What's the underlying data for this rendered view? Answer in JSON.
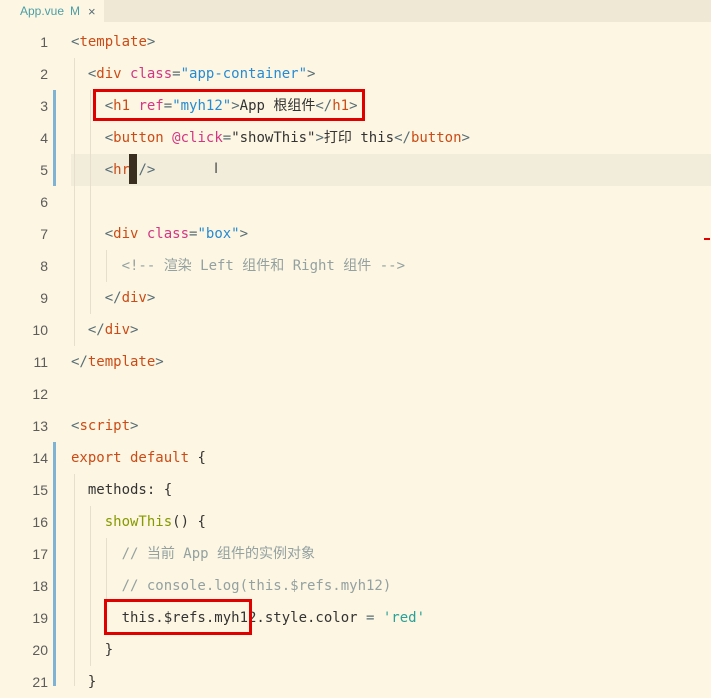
{
  "tab": {
    "filename": "App.vue",
    "status": "M",
    "close": "×"
  },
  "lines": [
    {
      "n": "1",
      "segs": [
        [
          "t-br",
          "<"
        ],
        [
          "t-tag",
          "template"
        ],
        [
          "t-br",
          ">"
        ]
      ]
    },
    {
      "n": "2",
      "segs": [
        [
          "t-br",
          "  <"
        ],
        [
          "t-tag",
          "div "
        ],
        [
          "t-attr",
          "class"
        ],
        [
          "t-br",
          "="
        ],
        [
          "t-str",
          "\"app-container\""
        ],
        [
          "t-br",
          ">"
        ]
      ]
    },
    {
      "n": "3",
      "segs": [
        [
          "t-br",
          "    <"
        ],
        [
          "t-tag",
          "h1 "
        ],
        [
          "t-attr",
          "ref"
        ],
        [
          "t-br",
          "="
        ],
        [
          "t-str",
          "\"myh12\""
        ],
        [
          "t-br",
          ">"
        ],
        [
          "t-text",
          "App 根组件"
        ],
        [
          "t-br",
          "</"
        ],
        [
          "t-tag",
          "h1"
        ],
        [
          "t-br",
          ">"
        ]
      ]
    },
    {
      "n": "4",
      "segs": [
        [
          "t-br",
          "    <"
        ],
        [
          "t-tag",
          "button "
        ],
        [
          "t-attr",
          "@click"
        ],
        [
          "t-br",
          "="
        ],
        [
          "t-text",
          "\"showThis\""
        ],
        [
          "t-br",
          ">"
        ],
        [
          "t-text",
          "打印 this"
        ],
        [
          "t-br",
          "</"
        ],
        [
          "t-tag",
          "button"
        ],
        [
          "t-br",
          ">"
        ]
      ]
    },
    {
      "n": "5",
      "segs": [
        [
          "t-br",
          "    <"
        ],
        [
          "t-tag",
          "hr"
        ],
        [
          "t-br",
          " />"
        ]
      ]
    },
    {
      "n": "6",
      "segs": []
    },
    {
      "n": "7",
      "segs": [
        [
          "t-br",
          "    <"
        ],
        [
          "t-tag",
          "div "
        ],
        [
          "t-attr",
          "class"
        ],
        [
          "t-br",
          "="
        ],
        [
          "t-str",
          "\"box\""
        ],
        [
          "t-br",
          ">"
        ]
      ]
    },
    {
      "n": "8",
      "segs": [
        [
          "t-comm",
          "      <!-- 渲染 Left 组件和 Right 组件 -->"
        ]
      ]
    },
    {
      "n": "9",
      "segs": [
        [
          "t-br",
          "    </"
        ],
        [
          "t-tag",
          "div"
        ],
        [
          "t-br",
          ">"
        ]
      ]
    },
    {
      "n": "10",
      "segs": [
        [
          "t-br",
          "  </"
        ],
        [
          "t-tag",
          "div"
        ],
        [
          "t-br",
          ">"
        ]
      ]
    },
    {
      "n": "11",
      "segs": [
        [
          "t-br",
          "</"
        ],
        [
          "t-tag",
          "template"
        ],
        [
          "t-br",
          ">"
        ]
      ]
    },
    {
      "n": "12",
      "segs": []
    },
    {
      "n": "13",
      "segs": [
        [
          "t-br",
          "<"
        ],
        [
          "t-tag",
          "script"
        ],
        [
          "t-br",
          ">"
        ]
      ]
    },
    {
      "n": "14",
      "segs": [
        [
          "t-kw",
          "export default "
        ],
        [
          "t-plain",
          "{"
        ]
      ]
    },
    {
      "n": "15",
      "segs": [
        [
          "t-plain",
          "  methods: {"
        ]
      ]
    },
    {
      "n": "16",
      "segs": [
        [
          "t-fn",
          "    showThis"
        ],
        [
          "t-plain",
          "() {"
        ]
      ]
    },
    {
      "n": "17",
      "segs": [
        [
          "t-comm",
          "      // 当前 App 组件的实例对象"
        ]
      ]
    },
    {
      "n": "18",
      "segs": [
        [
          "t-comm",
          "      // console.log(this.$refs.myh12)"
        ]
      ]
    },
    {
      "n": "19",
      "segs": [
        [
          "t-plain",
          "      this.$refs.myh12.style.color "
        ],
        [
          "t-br",
          "= "
        ],
        [
          "t-sred",
          "'red'"
        ]
      ]
    },
    {
      "n": "20",
      "segs": [
        [
          "t-plain",
          "    }"
        ]
      ]
    },
    {
      "n": "21",
      "segs": [
        [
          "t-plain",
          "  }"
        ]
      ]
    }
  ],
  "cursor_icon": "text-cursor-icon"
}
